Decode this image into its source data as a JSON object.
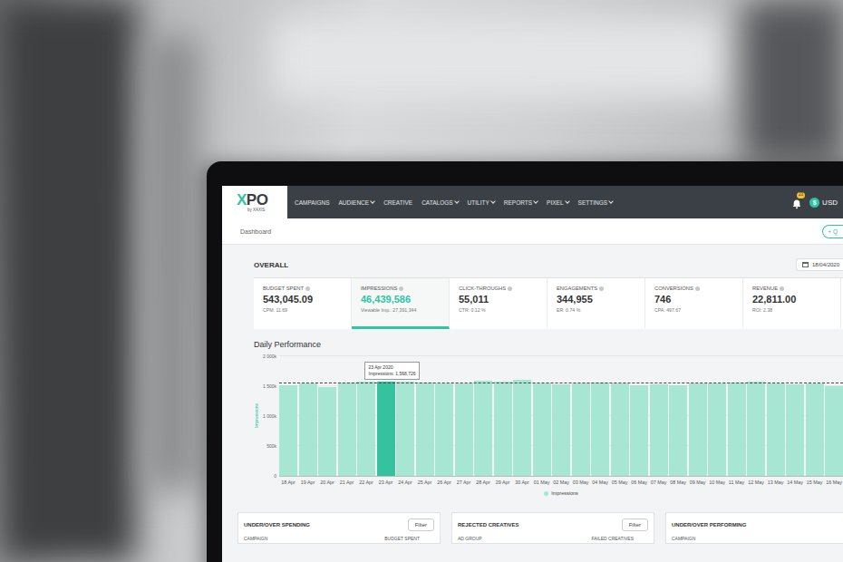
{
  "nav": {
    "logo": "XPO",
    "logo_sub": "by XAXIS",
    "items": [
      {
        "label": "CAMPAIGNS",
        "dropdown": false
      },
      {
        "label": "AUDIENCE",
        "dropdown": true
      },
      {
        "label": "CREATIVE",
        "dropdown": false
      },
      {
        "label": "CATALOGS",
        "dropdown": true
      },
      {
        "label": "UTILITY",
        "dropdown": true
      },
      {
        "label": "REPORTS",
        "dropdown": true
      },
      {
        "label": "PIXEL",
        "dropdown": true
      },
      {
        "label": "SETTINGS",
        "dropdown": true
      }
    ],
    "notification_count": "23",
    "currency_icon": "$",
    "currency": "USD"
  },
  "header": {
    "breadcrumb": "Dashboard",
    "action_button": "+ Q"
  },
  "overall": {
    "title": "OVERALL",
    "date": "18/04/2020",
    "metrics": [
      {
        "label": "BUDGET SPENT",
        "value": "543,045.09",
        "sub": "CPM: 11.69",
        "selected": false
      },
      {
        "label": "IMPRESSIONS",
        "value": "46,439,586",
        "sub": "Viewable Imp.: 27,391,344",
        "selected": true
      },
      {
        "label": "CLICK-THROUGHS",
        "value": "55,011",
        "sub": "CTR: 0.12 %",
        "selected": false
      },
      {
        "label": "ENGAGEMENTS",
        "value": "344,955",
        "sub": "ER: 0.74 %",
        "selected": false
      },
      {
        "label": "CONVERSIONS",
        "value": "746",
        "sub": "CPA: 497.67",
        "selected": false
      },
      {
        "label": "REVENUE",
        "value": "22,811.00",
        "sub": "ROI: 2.38",
        "selected": false
      }
    ]
  },
  "chart": {
    "title": "Daily Performance",
    "y_axis_label": "Impressions",
    "y_max": 2000,
    "average": 1540,
    "y_ticks": [
      "0",
      "500k",
      "1 000k",
      "1 500k",
      "2 000k"
    ],
    "x_labels": [
      {
        "label": "18 Apr",
        "selected": false
      },
      {
        "label": "19 Apr",
        "selected": false
      },
      {
        "label": "20 Apr",
        "selected": false
      },
      {
        "label": "21 Apr",
        "selected": false
      },
      {
        "label": "22 Apr",
        "selected": false
      },
      {
        "label": "23 Apr",
        "selected": true
      },
      {
        "label": "24 Apr",
        "selected": false
      },
      {
        "label": "25 Apr",
        "selected": false
      },
      {
        "label": "26 Apr",
        "selected": false
      },
      {
        "label": "27 Apr",
        "selected": false
      },
      {
        "label": "28 Apr",
        "selected": false
      },
      {
        "label": "29 Apr",
        "selected": false
      },
      {
        "label": "30 Apr",
        "selected": false
      },
      {
        "label": "01 May",
        "selected": false
      },
      {
        "label": "02 May",
        "selected": false
      },
      {
        "label": "03 May",
        "selected": false
      },
      {
        "label": "04 May",
        "selected": false
      },
      {
        "label": "05 May",
        "selected": false
      },
      {
        "label": "06 May",
        "selected": false
      },
      {
        "label": "07 May",
        "selected": false
      },
      {
        "label": "08 May",
        "selected": false
      },
      {
        "label": "09 May",
        "selected": false
      },
      {
        "label": "10 May",
        "selected": false
      },
      {
        "label": "11 May",
        "selected": false
      },
      {
        "label": "12 May",
        "selected": false
      },
      {
        "label": "13 May",
        "selected": false
      },
      {
        "label": "14 May",
        "selected": false
      },
      {
        "label": "15 May",
        "selected": false
      },
      {
        "label": "16 May",
        "selected": false
      }
    ],
    "series": [
      {
        "name": "Impressions",
        "values": [
          1520,
          1540,
          1480,
          1560,
          1580,
          1568.726,
          1570,
          1560,
          1540,
          1550,
          1590,
          1570,
          1610,
          1540,
          1530,
          1550,
          1560,
          1540,
          1520,
          1530,
          1520,
          1540,
          1550,
          1560,
          1570,
          1540,
          1530,
          1550,
          1500
        ]
      }
    ],
    "tooltip": {
      "title": "23 Apr 2020:",
      "text": "Impressions: 1,568,726"
    },
    "legend": "Impressions"
  },
  "panels": [
    {
      "title": "UNDER/OVER SPENDING",
      "filter": "Filter",
      "columns": [
        "CAMPAIGN",
        "BUDGET SPENT"
      ]
    },
    {
      "title": "REJECTED CREATIVES",
      "filter": "Filter",
      "columns": [
        "AD GROUP",
        "FAILED CREATIVES"
      ]
    },
    {
      "title": "UNDER/OVER PERFORMING",
      "columns": [
        "CAMPAIGN"
      ]
    }
  ]
}
